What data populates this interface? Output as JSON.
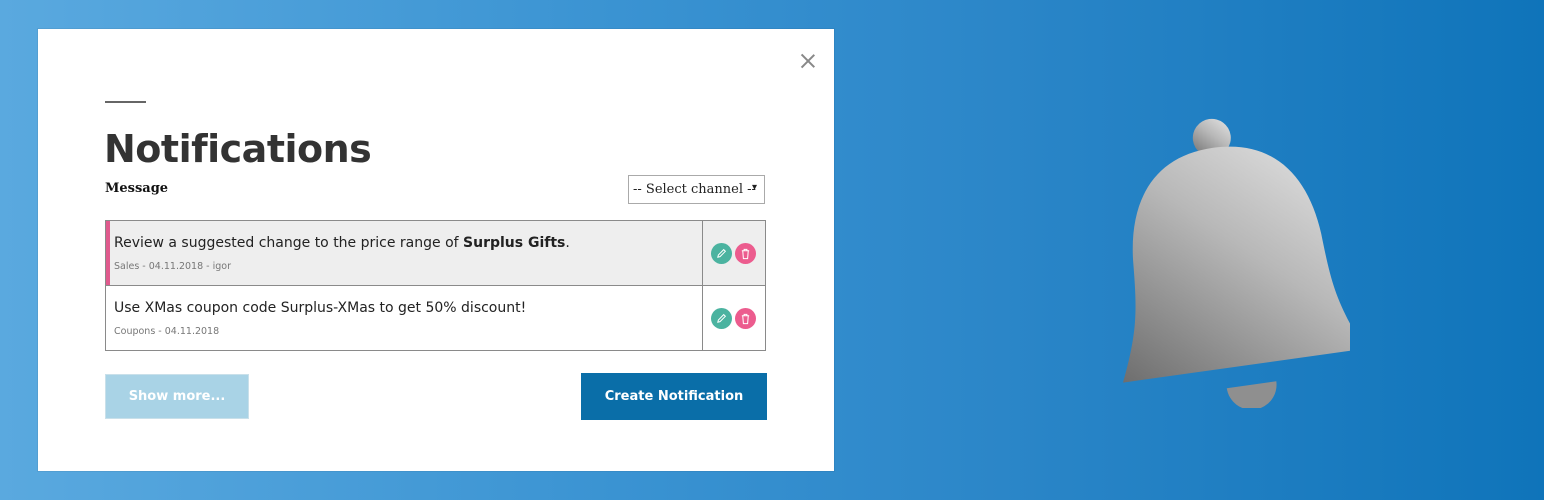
{
  "modal": {
    "title": "Notifications",
    "message_label": "Message",
    "channel_select": {
      "selected": "-- Select channel --",
      "arrow": "▾"
    },
    "notifications": [
      {
        "text_before": "Review a suggested change to the price range of ",
        "text_bold": "Surplus Gifts",
        "text_after": ".",
        "meta": "Sales - 04.11.2018 - igor",
        "unread": true
      },
      {
        "text_before": "Use XMas coupon code Surplus-XMas to get 50% discount!",
        "text_bold": "",
        "text_after": "",
        "meta": "Coupons - 04.11.2018",
        "unread": false
      }
    ],
    "show_more_label": "Show more...",
    "create_label": "Create Notification"
  },
  "colors": {
    "accent_pink": "#e05a8d",
    "edit_green": "#4bb3a0",
    "delete_pink": "#ec5c8e",
    "primary_blue": "#0a6ea8",
    "disabled_blue": "#a9d3e6"
  },
  "icons": {
    "close": "close-icon",
    "edit": "pencil-icon",
    "delete": "trash-icon",
    "decoration": "bell-icon"
  }
}
